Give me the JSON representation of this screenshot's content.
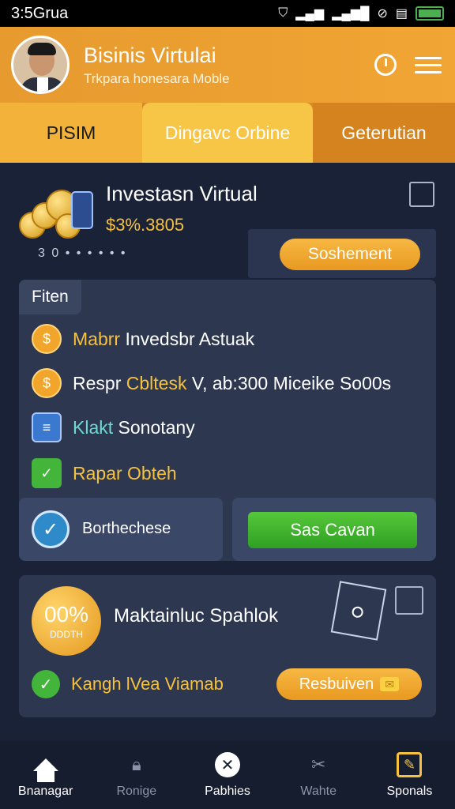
{
  "status_bar": {
    "time": "3:5Grua",
    "battery_level": 1.0
  },
  "header": {
    "title": "Bisinis Virtulai",
    "subtitle": "Trkpara honesara Moble",
    "icons": [
      "clock-icon",
      "menu-icon"
    ]
  },
  "tabs": [
    {
      "label": "PISIM"
    },
    {
      "label": "Dingavc Orbine"
    },
    {
      "label": "Geterutian"
    }
  ],
  "invest": {
    "title": "Investasn Virtual",
    "amount": "$3%.3805",
    "dots_text": "3 0 • • • • • •",
    "button_label": "Soshement"
  },
  "features": {
    "label": "Fiten",
    "items": [
      {
        "prefix": "Mabrr",
        "text": "Invedsbr Astuak",
        "icon": "coin-icon"
      },
      {
        "prefix": "Respr",
        "accent": "Cbltesk",
        "text": "V, ab:300 Miceike So00s",
        "icon": "coin-icon"
      },
      {
        "prefix": "Klakt",
        "text": "Sonotany",
        "icon": "card-icon"
      },
      {
        "text": "Rapar Obteh",
        "icon": "check-icon"
      }
    ],
    "box_label": "Borthechese",
    "green_button": "Sas Cavan"
  },
  "reward": {
    "badge_value": "00%",
    "badge_sub": "DDDTH",
    "title": "Maktainluc Spahlok",
    "row_text": "Kangh lVea Viamab",
    "button_label": "Resbuiven"
  },
  "navbar": [
    {
      "label": "Bnanagar",
      "icon": "home-icon"
    },
    {
      "label": "Ronige",
      "icon": "lock-icon"
    },
    {
      "label": "Pabhies",
      "icon": "compass-icon"
    },
    {
      "label": "Wahte",
      "icon": "tools-icon"
    },
    {
      "label": "Sponals",
      "icon": "edit-icon"
    }
  ]
}
